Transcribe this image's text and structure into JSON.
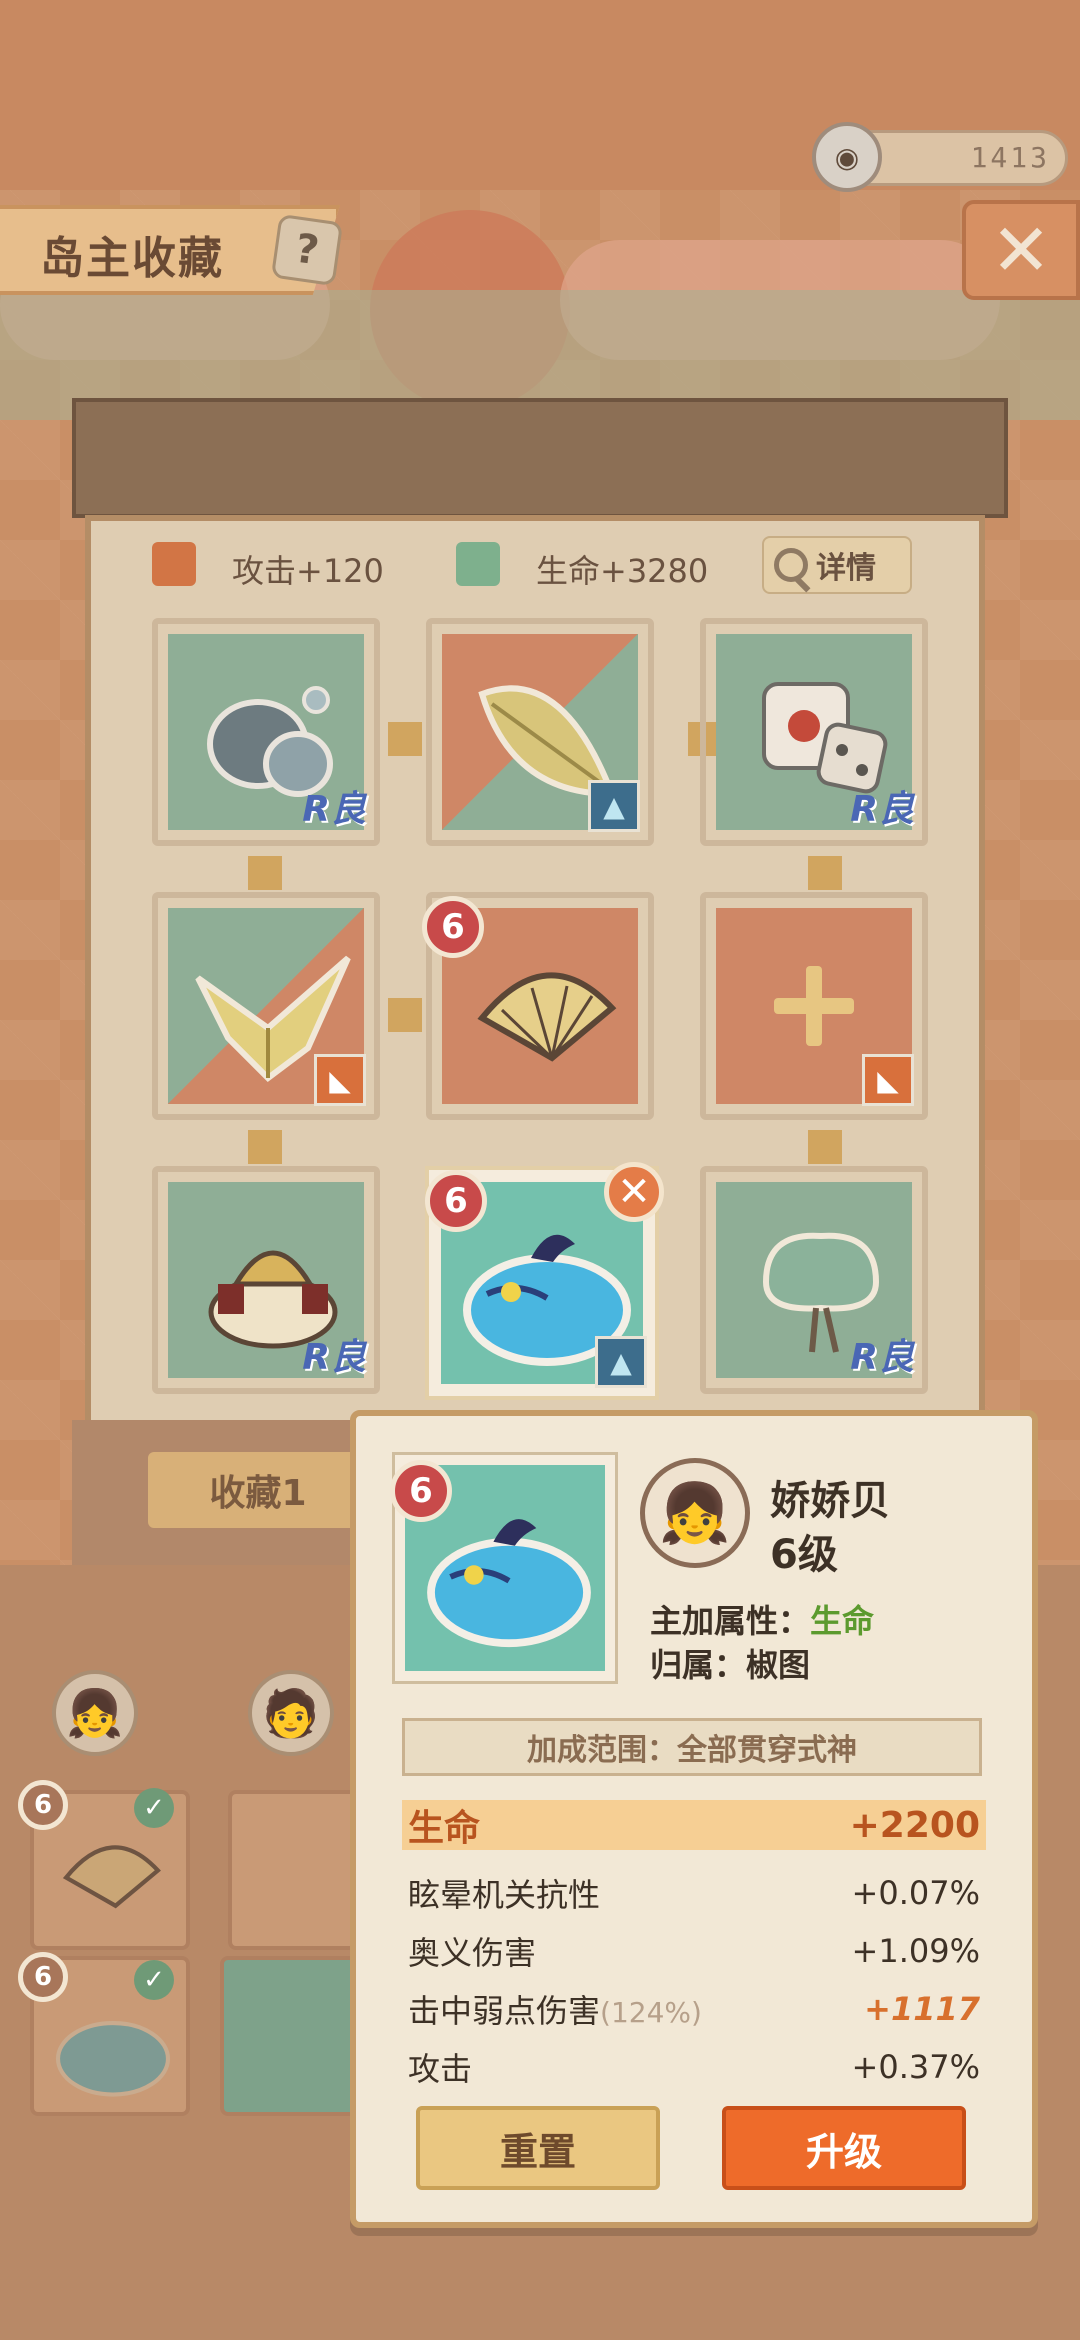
{
  "header": {
    "currency_value": "1413",
    "title": "岛主收藏",
    "help_label": "?",
    "close_label": "✕"
  },
  "board": {
    "stats": [
      {
        "label": "攻击+120",
        "color": "#d27545"
      },
      {
        "label": "生命+3280",
        "color": "#7eb08d"
      }
    ],
    "detail_label": "详情",
    "collection_tab": "收藏1",
    "slots": [
      {
        "kind": "stone-icon",
        "rarity": "R良"
      },
      {
        "kind": "leaf-icon",
        "rarity": "badge-blue"
      },
      {
        "kind": "dice-icon",
        "rarity": "R良"
      },
      {
        "kind": "origami-bird-icon",
        "rarity": "badge-orange"
      },
      {
        "kind": "folding-fan-icon",
        "level": "6",
        "rarity": ""
      },
      {
        "kind": "empty-add-slot",
        "rarity": "badge-orange"
      },
      {
        "kind": "armor-icon",
        "rarity": "R良"
      },
      {
        "kind": "slime-icon",
        "level": "6",
        "rarity": "badge-blue",
        "selected": true
      },
      {
        "kind": "tree-icon",
        "rarity": "R良"
      }
    ]
  },
  "popup": {
    "level_badge": "6",
    "owner_name": "娇娇贝",
    "owner_level": "6级",
    "main_attr_label": "主加属性：",
    "main_attr_value": "生命",
    "belong_label": "归属：",
    "belong_value": "椒图",
    "range_text": "加成范围：全部贯穿式神",
    "stats": [
      {
        "label": "生命",
        "value": "+2200",
        "highlight": true
      },
      {
        "label": "眩晕机关抗性",
        "value": "+0.07%"
      },
      {
        "label": "奥义伤害",
        "value": "+1.09%"
      },
      {
        "label": "击中弱点伤害",
        "sub": "(124%)",
        "value": "+1117",
        "orange": true
      },
      {
        "label": "攻击",
        "value": "+0.37%"
      }
    ],
    "reset_label": "重置",
    "upgrade_label": "升级"
  },
  "inventory": {
    "levels": [
      "6",
      "6"
    ]
  },
  "colors": {
    "accent_orange": "#ee6b2a",
    "attr_green": "#5c9a2e",
    "level_red": "#c84a4a"
  }
}
